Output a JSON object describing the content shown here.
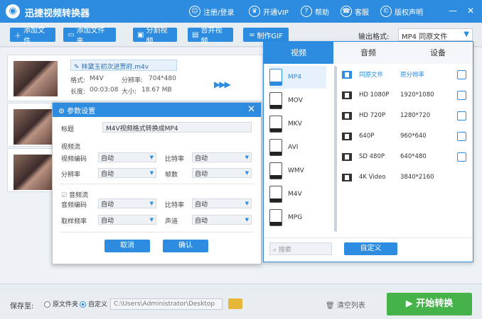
{
  "app": {
    "title": "迅捷视频转换器",
    "nav": [
      {
        "label": "注册/登录",
        "icon": "user-icon"
      },
      {
        "label": "开通VIP",
        "icon": "vip-icon"
      },
      {
        "label": "帮助",
        "icon": "help-icon"
      },
      {
        "label": "客服",
        "icon": "service-icon"
      },
      {
        "label": "版权声明",
        "icon": "copyright-icon"
      }
    ],
    "window_controls": [
      "—",
      "✕"
    ]
  },
  "toolbar": {
    "buttons": [
      {
        "label": "添加文件",
        "icon": "plus-icon"
      },
      {
        "label": "添加文件夹",
        "icon": "folder-add-icon"
      },
      {
        "label": "分割视频",
        "icon": "split-icon"
      },
      {
        "label": "合并视频",
        "icon": "merge-icon"
      },
      {
        "label": "制作GIF",
        "icon": "gif-icon"
      }
    ],
    "output_format_label": "输出格式:",
    "output_format_value": "MP4 同原文件"
  },
  "file": {
    "name": "林黛玉初次进贾府.m4v",
    "format_label": "格式:",
    "format": "M4V",
    "resolution_label": "分辨率:",
    "resolution": "704*480",
    "duration_label": "长度:",
    "duration": "00:03:08",
    "size_label": "大小:",
    "size": "18.67 MB"
  },
  "dialog": {
    "title": "参数设置",
    "title_field_label": "标题",
    "title_field_value": "M4V视频格式转换成MP4",
    "video_section": "视频流",
    "video_encoder_label": "视频编码",
    "bitrate_label": "比特率",
    "resolution_label": "分辨率",
    "framerate_label": "帧数",
    "audio_section": "音频流",
    "audio_encoder_label": "音频编码",
    "audio_bitrate_label": "比特率",
    "samplerate_label": "取样频率",
    "channel_label": "声道",
    "auto": "自动",
    "cancel": "取消",
    "ok": "确认"
  },
  "format_panel": {
    "tabs": [
      "视频",
      "音频",
      "设备"
    ],
    "formats": [
      "MP4",
      "MOV",
      "MKV",
      "AVI",
      "WMV",
      "M4V",
      "MPG"
    ],
    "selected_format": "MP4",
    "qualities": [
      {
        "name": "同原文件",
        "res": "原分辨率"
      },
      {
        "name": "HD 1080P",
        "res": "1920*1080"
      },
      {
        "name": "HD 720P",
        "res": "1280*720"
      },
      {
        "name": "640P",
        "res": "960*640"
      },
      {
        "name": "SD 480P",
        "res": "640*480"
      },
      {
        "name": "4K Video",
        "res": "3840*2160"
      }
    ],
    "search_placeholder": "搜索",
    "custom_button": "自定义"
  },
  "bottom": {
    "save_to_label": "保存至:",
    "option_source": "原文件夹",
    "option_custom": "自定义",
    "path": "C:\\Users\\Administrator\\Desktop",
    "clear_list": "清空列表",
    "start": "开始转换"
  },
  "colors": {
    "primary": "#2d8ce0",
    "start": "#46b24a"
  }
}
